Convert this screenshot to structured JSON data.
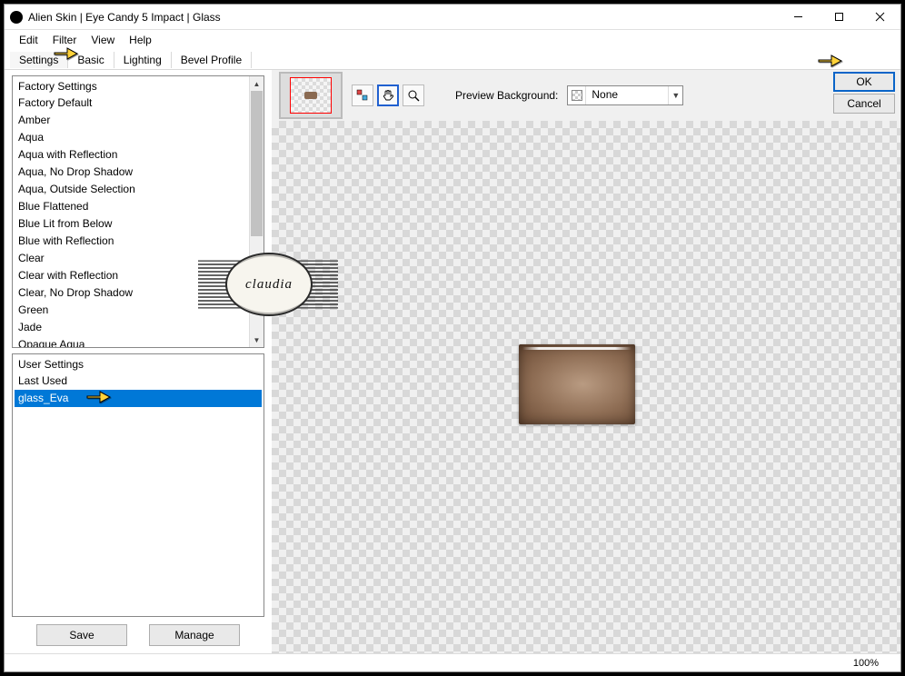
{
  "window": {
    "title": "Alien Skin | Eye Candy 5 Impact | Glass"
  },
  "menubar": {
    "items": [
      "Edit",
      "Filter",
      "View",
      "Help"
    ]
  },
  "tabs": {
    "items": [
      "Settings",
      "Basic",
      "Lighting",
      "Bevel Profile"
    ],
    "active": 0
  },
  "factory": {
    "header": "Factory Settings",
    "items": [
      "Factory Default",
      "Amber",
      "Aqua",
      "Aqua with Reflection",
      "Aqua, No Drop Shadow",
      "Aqua, Outside Selection",
      "Blue Flattened",
      "Blue Lit from Below",
      "Blue with Reflection",
      "Clear",
      "Clear with Reflection",
      "Clear, No Drop Shadow",
      "Green",
      "Jade",
      "Opaque Aqua"
    ]
  },
  "user": {
    "header": "User Settings",
    "items": [
      "Last Used",
      "glass_Eva"
    ],
    "selected_index": 1
  },
  "buttons": {
    "save": "Save",
    "manage": "Manage"
  },
  "preview": {
    "label": "Preview Background:",
    "value": "None"
  },
  "actions": {
    "ok": "OK",
    "cancel": "Cancel"
  },
  "status": {
    "zoom": "100%"
  },
  "watermark": {
    "text": "claudia"
  },
  "tool_icons": {
    "colorpick": "color-sample-icon",
    "hand": "hand-icon",
    "zoom": "zoom-icon"
  }
}
